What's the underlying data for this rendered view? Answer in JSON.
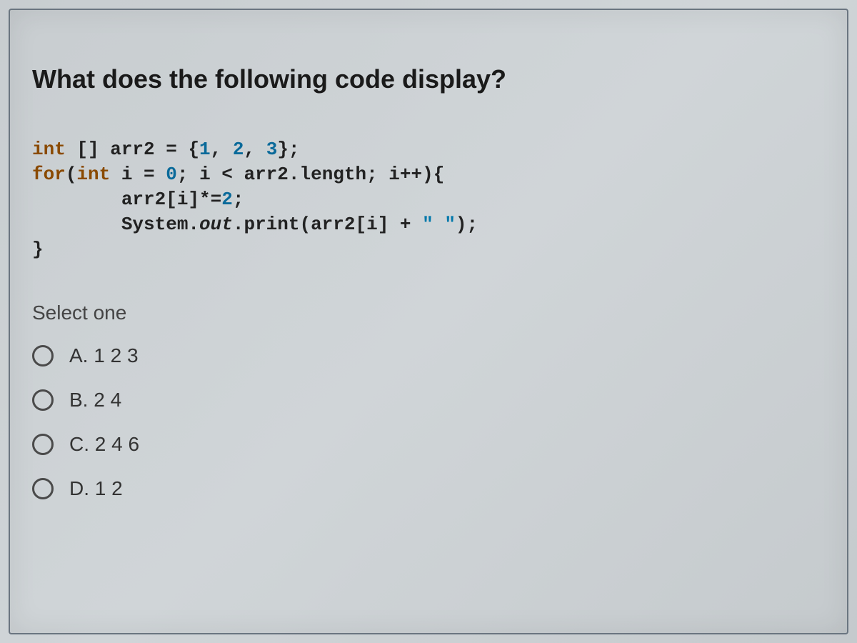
{
  "question": {
    "title": "What does the following code display?",
    "code_lines": {
      "l1a": "int",
      "l1b": " [] arr2 = {",
      "l1c": "1",
      "l1d": ", ",
      "l1e": "2",
      "l1f": ", ",
      "l1g": "3",
      "l1h": "};",
      "l2a": "for",
      "l2b": "(",
      "l2c": "int",
      "l2d": " i = ",
      "l2e": "0",
      "l2f": "; i < arr2.length; i++){",
      "l3a": "        arr2[i]*=",
      "l3b": "2",
      "l3c": ";",
      "l4a": "        System.",
      "l4b": "out",
      "l4c": ".print(arr2[i] + ",
      "l4d": "\" \"",
      "l4e": ");",
      "l5": "}"
    },
    "select_label": "Select one",
    "options": [
      {
        "label": "A. 1 2 3"
      },
      {
        "label": "B. 2 4"
      },
      {
        "label": "C. 2 4 6"
      },
      {
        "label": "D. 1 2"
      }
    ]
  }
}
